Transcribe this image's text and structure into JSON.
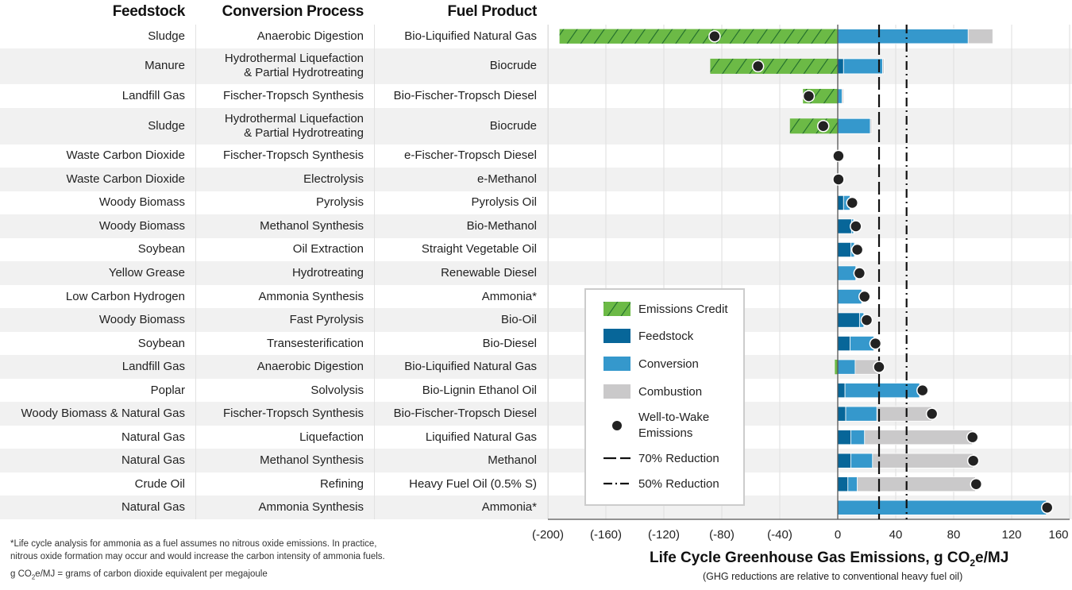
{
  "headers": {
    "feedstock": "Feedstock",
    "process": "Conversion Process",
    "product": "Fuel Product"
  },
  "colors": {
    "credit": "#6cba46",
    "credit_hatch": "#1f6b2c",
    "feedstock": "#076699",
    "conversion": "#3598cc",
    "combustion": "#cac9ca",
    "wtw": "#222222",
    "row_alt": "#f1f1f1"
  },
  "chart_data": {
    "type": "bar",
    "orientation": "horizontal-stacked",
    "xlabel": "Life Cycle Greenhouse Gas Emissions, g CO2e/MJ",
    "xlabel_main": "Life Cycle Greenhouse Gas Emissions, g CO",
    "xlabel_sub": "2",
    "xlabel_tail": "e/MJ",
    "subtitle": "(GHG reductions are relative to conventional heavy fuel oil)",
    "xlim": [
      -200,
      160
    ],
    "xticks": [
      -200,
      -160,
      -120,
      -80,
      -40,
      0,
      40,
      80,
      120,
      160
    ],
    "xtick_labels": [
      "(-200)",
      "(-160)",
      "(-120)",
      "(-80)",
      "(-40)",
      "0",
      "40",
      "80",
      "120",
      "160"
    ],
    "grid": true,
    "reference_lines": [
      {
        "name": "70% Reduction",
        "value": 28.5,
        "style": "dashed"
      },
      {
        "name": "50% Reduction",
        "value": 47.5,
        "style": "dash-dot"
      }
    ],
    "legend": {
      "placement": "lower-left-of-plot",
      "entries": [
        "Emissions Credit",
        "Feedstock",
        "Conversion",
        "Combustion",
        "Well-to-Wake Emissions",
        "70% Reduction",
        "50% Reduction"
      ]
    },
    "rows": [
      {
        "feedstock": "Sludge",
        "process": "Anaerobic Digestion",
        "product": "Bio-Liquified Natural Gas",
        "credit": -192,
        "feedstock_val": 0,
        "conversion": 90,
        "combustion": 17,
        "wtw": -85
      },
      {
        "feedstock": "Manure",
        "process": "Hydrothermal Liquefaction & Partial Hydrotreating",
        "process_lines": [
          "Hydrothermal Liquefaction",
          "& Partial Hydrotreating"
        ],
        "product": "Biocrude",
        "credit": -88,
        "feedstock_val": 4,
        "conversion": 27,
        "combustion": 1,
        "wtw": -55
      },
      {
        "feedstock": "Landfill Gas",
        "process": "Fischer-Tropsch Synthesis",
        "product": "Bio-Fischer-Tropsch Diesel",
        "credit": -24,
        "feedstock_val": 0,
        "conversion": 3,
        "combustion": 1,
        "wtw": -20
      },
      {
        "feedstock": "Sludge",
        "process": "Hydrothermal Liquefaction & Partial Hydrotreating",
        "process_lines": [
          "Hydrothermal Liquefaction",
          "& Partial Hydrotreating"
        ],
        "product": "Biocrude",
        "credit": -33,
        "feedstock_val": 0,
        "conversion": 22.5,
        "combustion": 1,
        "wtw": -10
      },
      {
        "feedstock": "Waste Carbon Dioxide",
        "process": "Fischer-Tropsch Synthesis",
        "product": "e-Fischer-Tropsch Diesel",
        "credit": 0,
        "feedstock_val": 0,
        "conversion": 0,
        "combustion": 0,
        "wtw": 0.5
      },
      {
        "feedstock": "Waste Carbon Dioxide",
        "process": "Electrolysis",
        "product": "e-Methanol",
        "credit": 0,
        "feedstock_val": 0,
        "conversion": 0.5,
        "combustion": 0,
        "wtw": 0.5
      },
      {
        "feedstock": "Woody Biomass",
        "process": "Pyrolysis",
        "product": "Pyrolysis Oil",
        "credit": 0,
        "feedstock_val": 4,
        "conversion": 4.5,
        "combustion": 0.5,
        "wtw": 10
      },
      {
        "feedstock": "Woody Biomass",
        "process": "Methanol Synthesis",
        "product": "Bio-Methanol",
        "credit": 0,
        "feedstock_val": 9.5,
        "conversion": 1.5,
        "combustion": 0.5,
        "wtw": 12.5
      },
      {
        "feedstock": "Soybean",
        "process": "Oil Extraction",
        "product": "Straight Vegetable Oil",
        "credit": 0,
        "feedstock_val": 9,
        "conversion": 2.5,
        "combustion": 0.5,
        "wtw": 13.5
      },
      {
        "feedstock": "Yellow Grease",
        "process": "Hydrotreating",
        "product": "Renewable Diesel",
        "credit": 0,
        "feedstock_val": 0,
        "conversion": 12.5,
        "combustion": 0.5,
        "wtw": 15
      },
      {
        "feedstock": "Low Carbon Hydrogen",
        "process": "Ammonia Synthesis",
        "product": "Ammonia*",
        "credit": 0,
        "feedstock_val": 0,
        "conversion": 16.5,
        "combustion": 0,
        "wtw": 18.5
      },
      {
        "feedstock": "Woody Biomass",
        "process": "Fast Pyrolysis",
        "product": "Bio-Oil",
        "credit": 0,
        "feedstock_val": 15,
        "conversion": 3,
        "combustion": 0.5,
        "wtw": 20
      },
      {
        "feedstock": "Soybean",
        "process": "Transesterification",
        "product": "Bio-Diesel",
        "credit": 0,
        "feedstock_val": 8.5,
        "conversion": 16.5,
        "combustion": 0.5,
        "wtw": 26
      },
      {
        "feedstock": "Landfill Gas",
        "process": "Anaerobic Digestion",
        "product": "Bio-Liquified Natural Gas",
        "credit": -2,
        "feedstock_val": 0,
        "conversion": 12,
        "combustion": 16.5,
        "wtw": 28.5
      },
      {
        "feedstock": "Poplar",
        "process": "Solvolysis",
        "product": "Bio-Lignin Ethanol Oil",
        "credit": 0,
        "feedstock_val": 5,
        "conversion": 51.5,
        "combustion": 0.5,
        "wtw": 58.5
      },
      {
        "feedstock": "Woody Biomass & Natural Gas",
        "process": "Fischer-Tropsch Synthesis",
        "product": "Bio-Fischer-Tropsch Diesel",
        "credit": 0,
        "feedstock_val": 5.5,
        "conversion": 21.5,
        "combustion": 38,
        "wtw": 65
      },
      {
        "feedstock": "Natural Gas",
        "process": "Liquefaction",
        "product": "Liquified Natural Gas",
        "credit": 0,
        "feedstock_val": 9,
        "conversion": 9.5,
        "combustion": 74.5,
        "wtw": 93
      },
      {
        "feedstock": "Natural Gas",
        "process": "Methanol Synthesis",
        "product": "Methanol",
        "credit": 0,
        "feedstock_val": 9,
        "conversion": 15,
        "combustion": 69.5,
        "wtw": 93.5
      },
      {
        "feedstock": "Crude Oil",
        "process": "Refining",
        "product": "Heavy Fuel Oil (0.5% S)",
        "credit": 0,
        "feedstock_val": 7,
        "conversion": 6.5,
        "combustion": 81.5,
        "wtw": 95.5
      },
      {
        "feedstock": "Natural Gas",
        "process": "Ammonia Synthesis",
        "product": "Ammonia*",
        "credit": 0,
        "feedstock_val": 0,
        "conversion": 144,
        "combustion": 0,
        "wtw": 144.5
      }
    ]
  },
  "legend_labels": {
    "credit": "Emissions Credit",
    "feedstock": "Feedstock",
    "conversion": "Conversion",
    "combustion": "Combustion",
    "wtw_1": "Well-to-Wake",
    "wtw_2": "Emissions",
    "r70": "70% Reduction",
    "r50": "50% Reduction"
  },
  "footnotes": {
    "ammonia": "*Life cycle analysis for ammonia as a fuel assumes no nitrous oxide emissions. In practice, nitrous oxide formation may occur and would increase the carbon intensity of ammonia fuels.",
    "unit_pre": "g CO",
    "unit_sub": "2",
    "unit_post": "e/MJ = grams of carbon dioxide equivalent per megajoule"
  }
}
